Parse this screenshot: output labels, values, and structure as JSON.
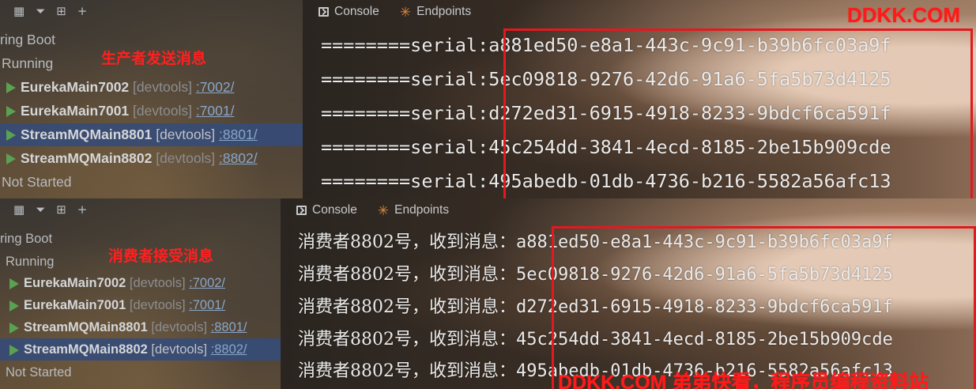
{
  "watermark_top": "DDKK.COM",
  "watermark_bottom": "DDKK.COM 弟弟快看，程序员编程资料站",
  "colors": {
    "annotation_red": "#ff2020",
    "highlight_box": "#e2191f",
    "run_green": "#5aa152",
    "selected_row": "#354b78"
  },
  "toolbar_icons": [
    "group-services-icon",
    "filter-icon",
    "add-service-icon",
    "add-icon"
  ],
  "top": {
    "services": {
      "group_spring_boot": "ring Boot",
      "group_running": "Running",
      "annotation": "生产者发送消息",
      "items": [
        {
          "name": "EurekaMain7002",
          "tag": "[devtools]",
          "port": ":7002/"
        },
        {
          "name": "EurekaMain7001",
          "tag": "[devtools]",
          "port": ":7001/"
        },
        {
          "name": "StreamMQMain8801",
          "tag": "[devtools]",
          "port": ":8801/"
        },
        {
          "name": "StreamMQMain8802",
          "tag": "[devtools]",
          "port": ":8802/"
        }
      ],
      "group_not_started": "Not Started"
    },
    "console": {
      "tab_console": "Console",
      "tab_endpoints": "Endpoints",
      "lines": [
        {
          "prefix": "========serial:",
          "uuid": "a881ed50-e8a1-443c-9c91-b39b6fc03a9f"
        },
        {
          "prefix": "========serial:",
          "uuid": "5ec09818-9276-42d6-91a6-5fa5b73d4125"
        },
        {
          "prefix": "========serial:",
          "uuid": "d272ed31-6915-4918-8233-9bdcf6ca591f"
        },
        {
          "prefix": "========serial:",
          "uuid": "45c254dd-3841-4ecd-8185-2be15b909cde"
        },
        {
          "prefix": "========serial:",
          "uuid": "495abedb-01db-4736-b216-5582a56afc13"
        }
      ]
    }
  },
  "bottom": {
    "services": {
      "group_spring_boot": "ring Boot",
      "group_running": "Running",
      "annotation": "消费者接受消息",
      "items": [
        {
          "name": "EurekaMain7002",
          "tag": "[devtools]",
          "port": ":7002/"
        },
        {
          "name": "EurekaMain7001",
          "tag": "[devtools]",
          "port": ":7001/"
        },
        {
          "name": "StreamMQMain8801",
          "tag": "[devtools]",
          "port": ":8801/"
        },
        {
          "name": "StreamMQMain8802",
          "tag": "[devtools]",
          "port": ":8802/"
        }
      ],
      "group_not_started": "Not Started"
    },
    "console": {
      "tab_console": "Console",
      "tab_endpoints": "Endpoints",
      "lines": [
        {
          "prefix": "消费者8802号，收到消息：",
          "uuid": "a881ed50-e8a1-443c-9c91-b39b6fc03a9f"
        },
        {
          "prefix": "消费者8802号，收到消息：",
          "uuid": "5ec09818-9276-42d6-91a6-5fa5b73d4125"
        },
        {
          "prefix": "消费者8802号，收到消息：",
          "uuid": "d272ed31-6915-4918-8233-9bdcf6ca591f"
        },
        {
          "prefix": "消费者8802号，收到消息：",
          "uuid": "45c254dd-3841-4ecd-8185-2be15b909cde"
        },
        {
          "prefix": "消费者8802号，收到消息：",
          "uuid": "495abedb-01db-4736-b216-5582a56afc13"
        }
      ]
    }
  }
}
